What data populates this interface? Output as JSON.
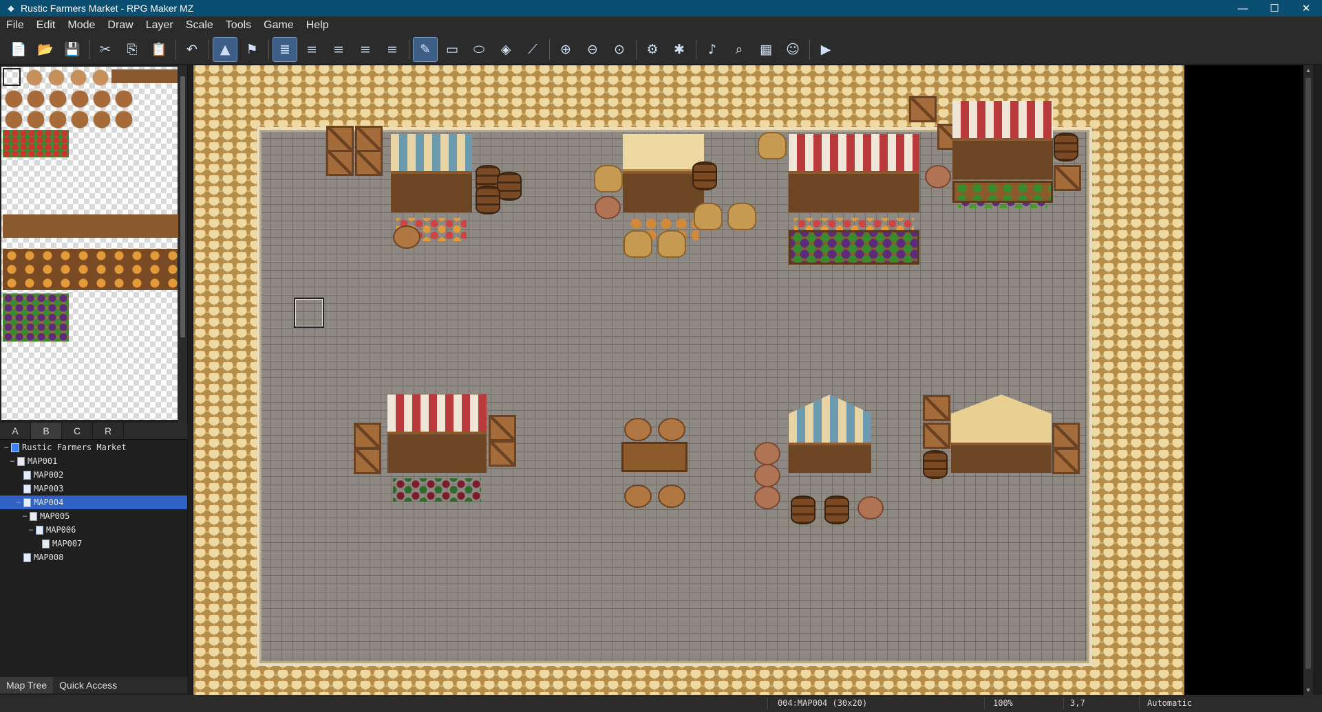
{
  "window": {
    "title": "Rustic Farmers Market - RPG Maker MZ",
    "minimize": "—",
    "maximize": "☐",
    "close": "✕"
  },
  "menu": [
    "File",
    "Edit",
    "Mode",
    "Draw",
    "Layer",
    "Scale",
    "Tools",
    "Game",
    "Help"
  ],
  "toolbar": {
    "groups": [
      [
        "new-project-icon",
        "open-project-icon",
        "save-project-icon"
      ],
      [
        "cut-icon",
        "copy-icon",
        "paste-icon"
      ],
      [
        "undo-icon"
      ],
      [
        "map-mode-icon",
        "event-mode-icon"
      ],
      [
        "layer-auto-icon",
        "layer-1-icon",
        "layer-2-icon",
        "layer-3-icon",
        "layer-4-icon"
      ],
      [
        "pencil-icon",
        "rectangle-icon",
        "ellipse-icon",
        "fill-icon",
        "shadow-pen-icon"
      ],
      [
        "zoom-in-icon",
        "zoom-out-icon",
        "zoom-actual-icon"
      ],
      [
        "database-icon",
        "plugin-manager-icon"
      ],
      [
        "sound-test-icon",
        "event-searcher-icon",
        "resource-manager-icon",
        "character-generator-icon"
      ],
      [
        "playtest-icon"
      ]
    ],
    "active": [
      "map-mode-icon",
      "layer-auto-icon",
      "pencil-icon"
    ]
  },
  "tileset_tabs": [
    "A",
    "B",
    "C",
    "R"
  ],
  "tileset_active_tab": "B",
  "map_tree": [
    {
      "label": "Rustic Farmers Market",
      "depth": 0,
      "type": "project",
      "expander": "−"
    },
    {
      "label": "MAP001",
      "depth": 1,
      "type": "map",
      "expander": "−"
    },
    {
      "label": "MAP002",
      "depth": 2,
      "type": "map",
      "expander": ""
    },
    {
      "label": "MAP003",
      "depth": 2,
      "type": "map",
      "expander": ""
    },
    {
      "label": "MAP004",
      "depth": 2,
      "type": "map",
      "expander": "−",
      "selected": true
    },
    {
      "label": "MAP005",
      "depth": 3,
      "type": "map",
      "expander": "−"
    },
    {
      "label": "MAP006",
      "depth": 4,
      "type": "map",
      "expander": "−"
    },
    {
      "label": "MAP007",
      "depth": 5,
      "type": "map",
      "expander": ""
    },
    {
      "label": "MAP008",
      "depth": 2,
      "type": "map",
      "expander": ""
    }
  ],
  "bottom_tabs": [
    "Map Tree",
    "Quick Access"
  ],
  "bottom_tab_active": "Map Tree",
  "status": {
    "map": "004:MAP004 (30x20)",
    "zoom": "100%",
    "coords": "3,7",
    "mode": "Automatic"
  },
  "colors": {
    "titlebar": "#0a4f72",
    "selection": "#2f62c4",
    "active_tool": "#3e5f85"
  }
}
